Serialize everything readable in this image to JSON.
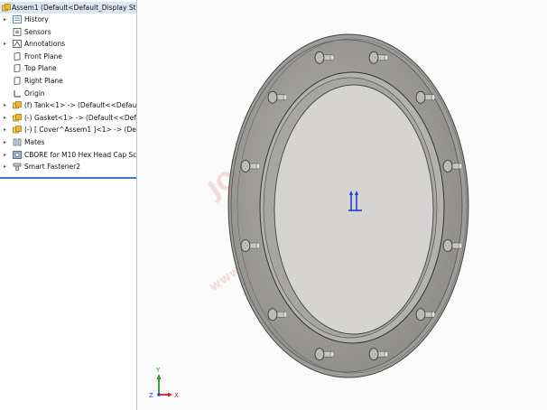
{
  "feature_tree": {
    "root": "Assem1  (Default<Default_Display State-1",
    "items": [
      {
        "label": "History",
        "icon": "history-icon",
        "expandable": true
      },
      {
        "label": "Sensors",
        "icon": "sensors-icon",
        "expandable": false
      },
      {
        "label": "Annotations",
        "icon": "annotations-icon",
        "expandable": true
      },
      {
        "label": "Front Plane",
        "icon": "plane-icon",
        "expandable": false
      },
      {
        "label": "Top Plane",
        "icon": "plane-icon",
        "expandable": false
      },
      {
        "label": "Right Plane",
        "icon": "plane-icon",
        "expandable": false
      },
      {
        "label": "Origin",
        "icon": "origin-icon",
        "expandable": false
      },
      {
        "label": "(f) Tank<1> -> (Default<<Default>_D",
        "icon": "part-icon",
        "expandable": true
      },
      {
        "label": "(-) Gasket<1> -> (Default<<Default>",
        "icon": "part-icon",
        "expandable": true
      },
      {
        "label": "(-) [ Cover^Assem1 ]<1> -> (Default-",
        "icon": "part-icon",
        "expandable": true
      },
      {
        "label": "Mates",
        "icon": "mates-icon",
        "expandable": true
      },
      {
        "label": "CBORE for M10 Hex Head Cap Screw",
        "icon": "hole-feature-icon",
        "expandable": true
      },
      {
        "label": "Smart Fastener2",
        "icon": "fastener-icon",
        "expandable": true
      }
    ]
  },
  "triad": {
    "x": "X",
    "y": "Y",
    "z": "Z"
  },
  "watermark": {
    "line1": "JOCHSUN",
    "line2": "卓 信",
    "line3": "www.jochsun.cn"
  },
  "colors": {
    "accent": "#3d7cc9",
    "part_yellow": "#e8b730",
    "axis_x": "#d42020",
    "axis_y": "#20a020",
    "axis_z": "#2040d0"
  }
}
